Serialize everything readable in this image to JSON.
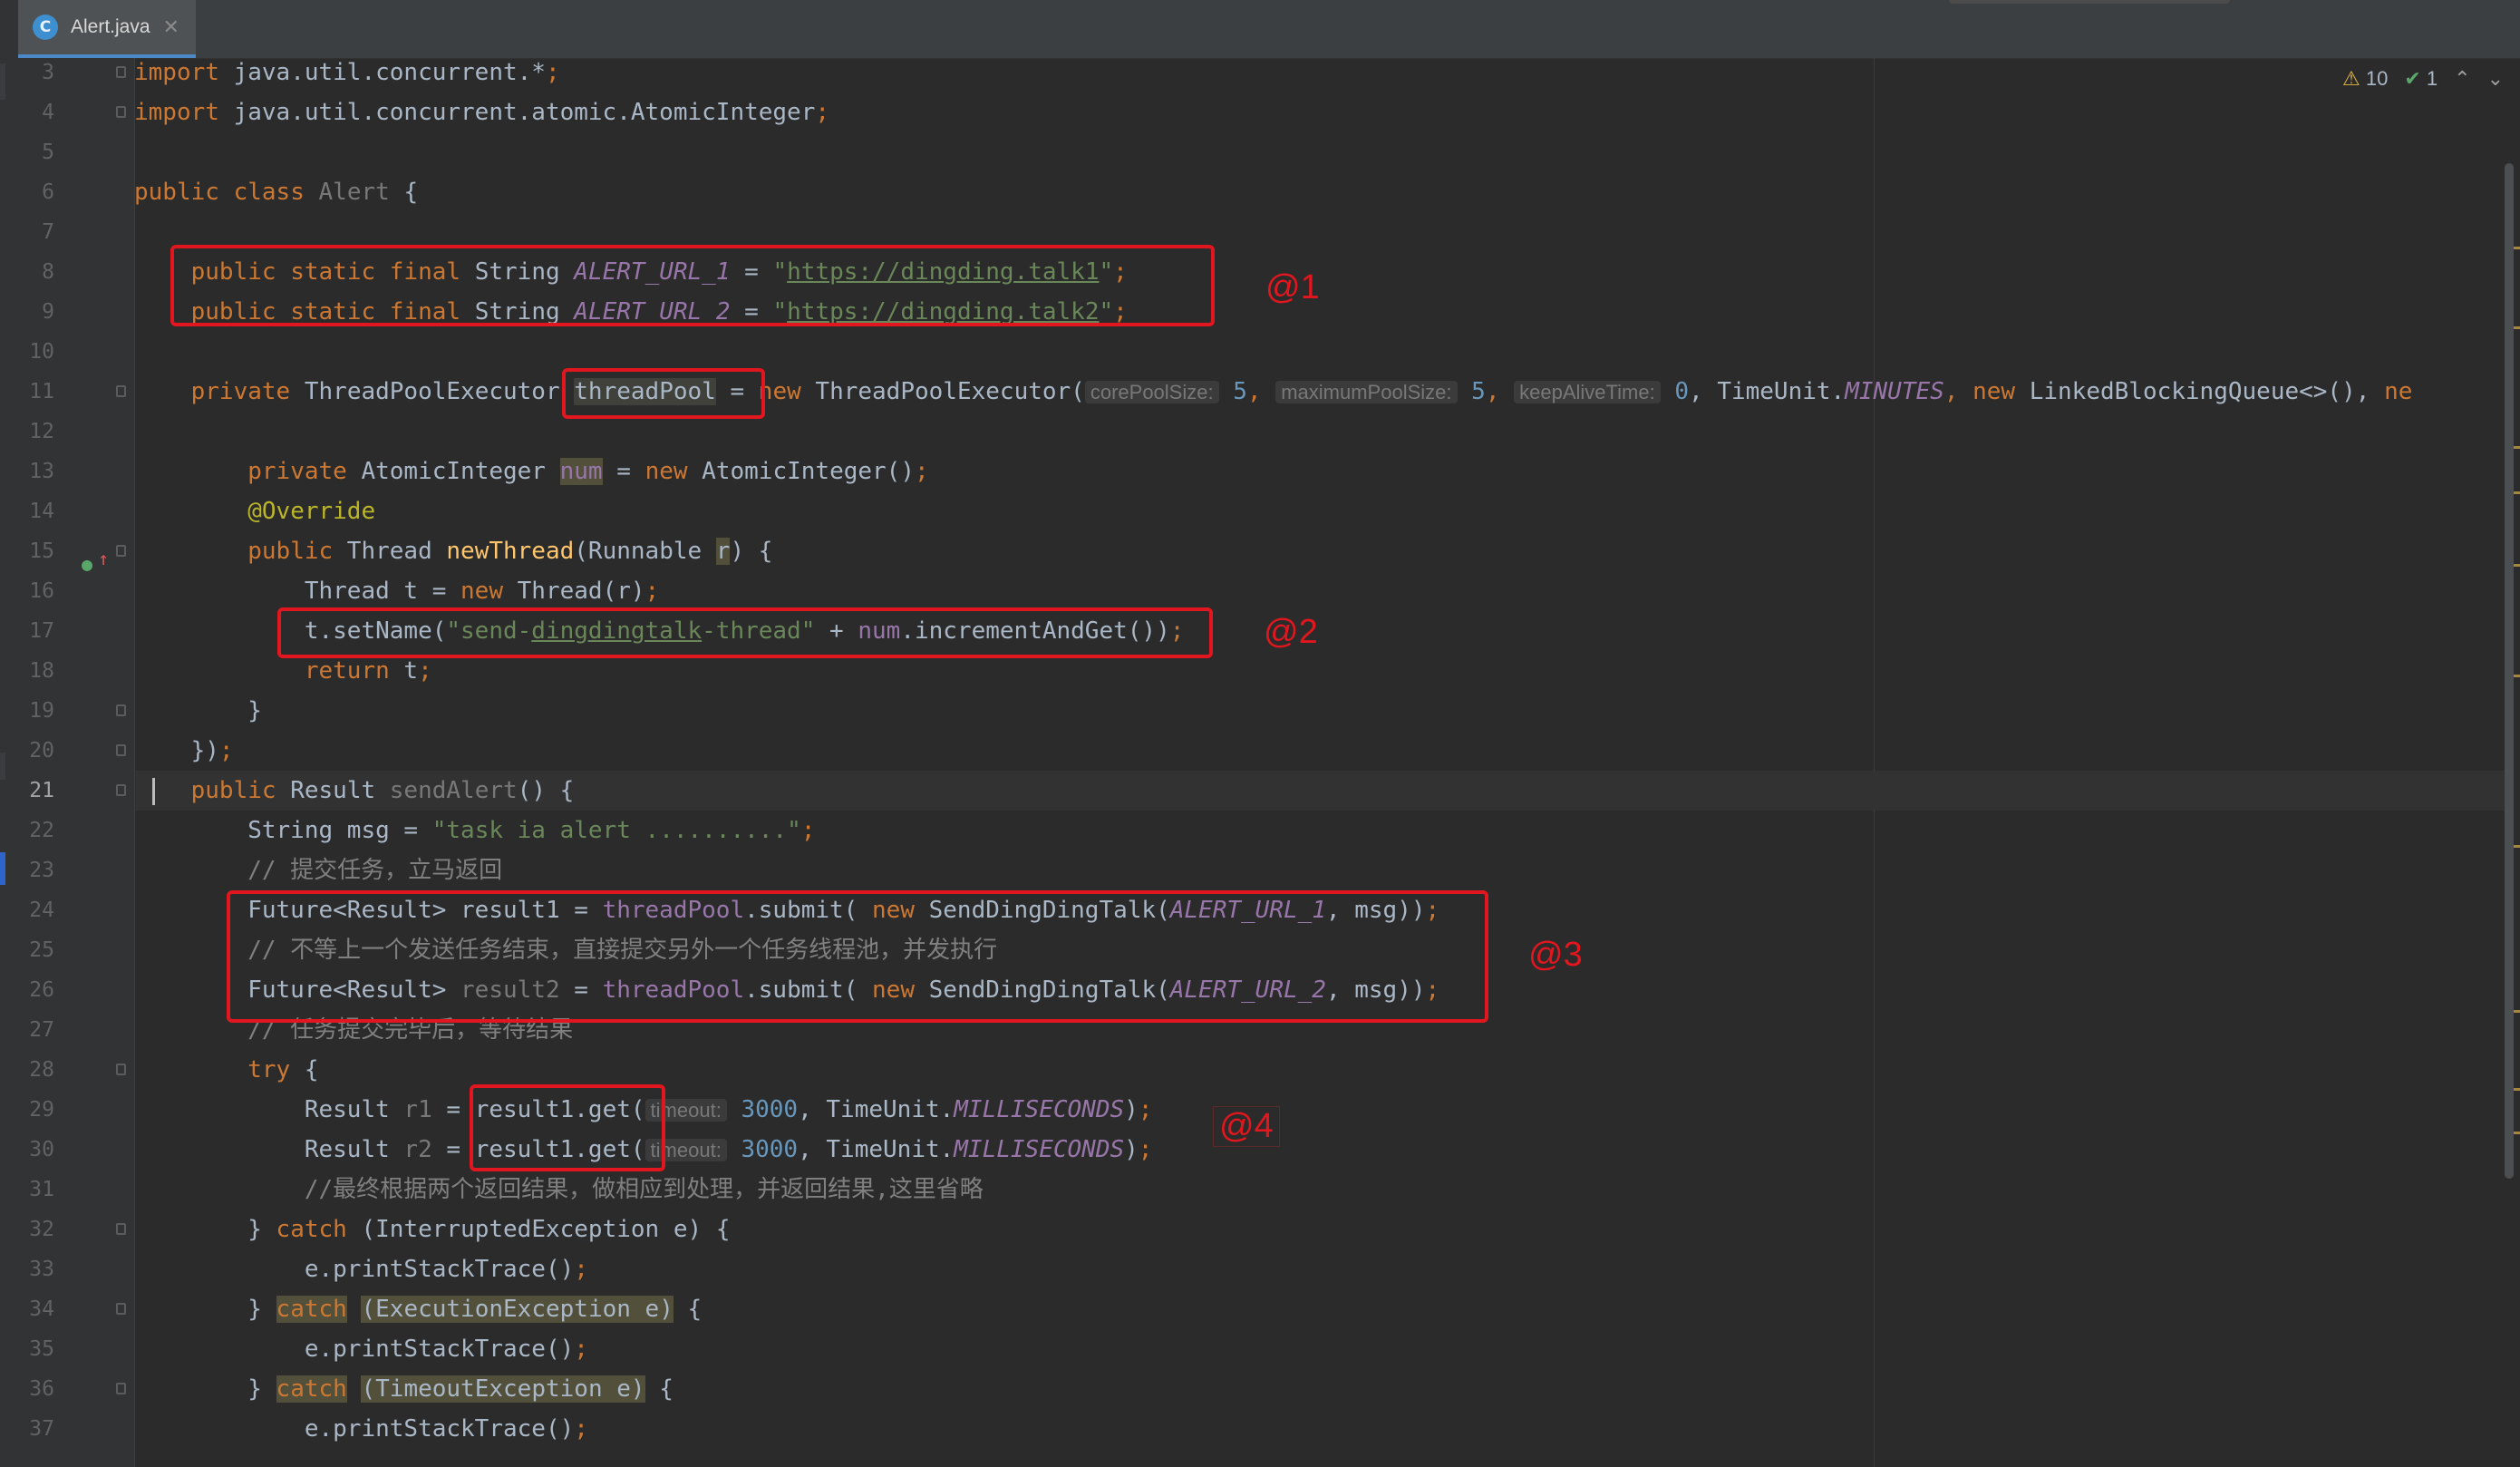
{
  "tab": {
    "icon": "C",
    "filename": "Alert.java",
    "close": "✕"
  },
  "inspections": {
    "warnings": "10",
    "ok": "1",
    "up": "⌃",
    "down": "⌄"
  },
  "line_numbers": [
    "3",
    "4",
    "5",
    "6",
    "7",
    "8",
    "9",
    "10",
    "11",
    "12",
    "13",
    "14",
    "15",
    "16",
    "17",
    "18",
    "19",
    "20",
    "21",
    "22",
    "23",
    "24",
    "25",
    "26",
    "27",
    "28",
    "29",
    "30",
    "31",
    "32",
    "33",
    "34",
    "35",
    "36",
    "37"
  ],
  "code": {
    "l3": [
      "import",
      " java.util.concurrent.*",
      ";"
    ],
    "l4": [
      "import",
      " java.util.concurrent.atomic.AtomicInteger",
      ";"
    ],
    "l6": [
      "public",
      " ",
      "class",
      " ",
      "Alert",
      " {"
    ],
    "l8": [
      "    ",
      "public",
      " ",
      "static",
      " ",
      "final",
      " String ",
      "ALERT_URL_1",
      " = ",
      "\"",
      "https://dingding.talk1",
      "\"",
      ";"
    ],
    "l9": [
      "    ",
      "public",
      " ",
      "static",
      " ",
      "final",
      " String ",
      "ALERT_URL_2",
      " = ",
      "\"",
      "https://dingding.talk2",
      "\"",
      ";"
    ],
    "l11": [
      "    ",
      "private",
      " ThreadPoolExecutor ",
      "threadPool",
      " = ",
      "new",
      " ThreadPoolExecutor(",
      "corePoolSize:",
      " ",
      "5",
      ", ",
      "maximumPoolSize:",
      " ",
      "5",
      ", ",
      "keepAliveTime:",
      " ",
      "0",
      ", TimeUnit.",
      "MINUTES",
      ", ",
      "new",
      " LinkedBlockingQueue<>(), ",
      "ne"
    ],
    "l13": [
      "        ",
      "private",
      " AtomicInteger ",
      "num",
      " = ",
      "new",
      " AtomicInteger()",
      ";"
    ],
    "l14": [
      "        ",
      "@Override"
    ],
    "l15": [
      "        ",
      "public",
      " Thread ",
      "newThread",
      "(Runnable ",
      "r",
      ") {"
    ],
    "l16": [
      "            Thread t = ",
      "new",
      " Thread(r)",
      ";"
    ],
    "l17": [
      "            t.setName(",
      "\"send-",
      "dingdingtalk",
      "-thread\"",
      " + ",
      "num",
      ".incrementAndGet())",
      ";"
    ],
    "l18": [
      "            ",
      "return",
      " t",
      ";"
    ],
    "l19": [
      "        }"
    ],
    "l20": [
      "    })",
      ";"
    ],
    "l21": [
      "    ",
      "public",
      " Result ",
      "sendAlert",
      "() {"
    ],
    "l22": [
      "        String msg = ",
      "\"task ia alert ..........\"",
      ";"
    ],
    "l23": [
      "        // 提交任务，立马返回"
    ],
    "l24": [
      "        Future<Result> result1 = ",
      "threadPool",
      ".submit( ",
      "new",
      " SendDingDingTalk(",
      "ALERT_URL_1",
      ", msg))",
      ";"
    ],
    "l25": [
      "        // 不等上一个发送任务结束，直接提交另外一个任务线程池，并发执行"
    ],
    "l26": [
      "        Future<Result> ",
      "result2",
      " = ",
      "threadPool",
      ".submit( ",
      "new",
      " SendDingDingTalk(",
      "ALERT_URL_2",
      ", msg))",
      ";"
    ],
    "l27": [
      "        // 任务提交完毕后，等待结果"
    ],
    "l28": [
      "        ",
      "try",
      " {"
    ],
    "l29": [
      "            Result ",
      "r1",
      " = result1.get(",
      "timeout:",
      " ",
      "3000",
      ", TimeUnit.",
      "MILLISECONDS",
      ")",
      ";"
    ],
    "l30": [
      "            Result ",
      "r2",
      " = result1.get(",
      "timeout:",
      " ",
      "3000",
      ", TimeUnit.",
      "MILLISECONDS",
      ")",
      ";"
    ],
    "l31": [
      "            //最终根据两个返回结果，做相应到处理，并返回结果,这里省略"
    ],
    "l32": [
      "        } ",
      "catch",
      " (InterruptedException e) {"
    ],
    "l33": [
      "            e.printStackTrace()",
      ";"
    ],
    "l34": [
      "        } ",
      "catch",
      " ",
      "(ExecutionException e)",
      " {"
    ],
    "l35": [
      "            e.printStackTrace()",
      ";"
    ],
    "l36": [
      "        } ",
      "catch",
      " ",
      "(TimeoutException e)",
      " {"
    ],
    "l37": [
      "            e.printStackTrace()",
      ";"
    ]
  },
  "annotations": {
    "a1": "@1",
    "a2": "@2",
    "a3": "@3",
    "a4": "@4"
  }
}
